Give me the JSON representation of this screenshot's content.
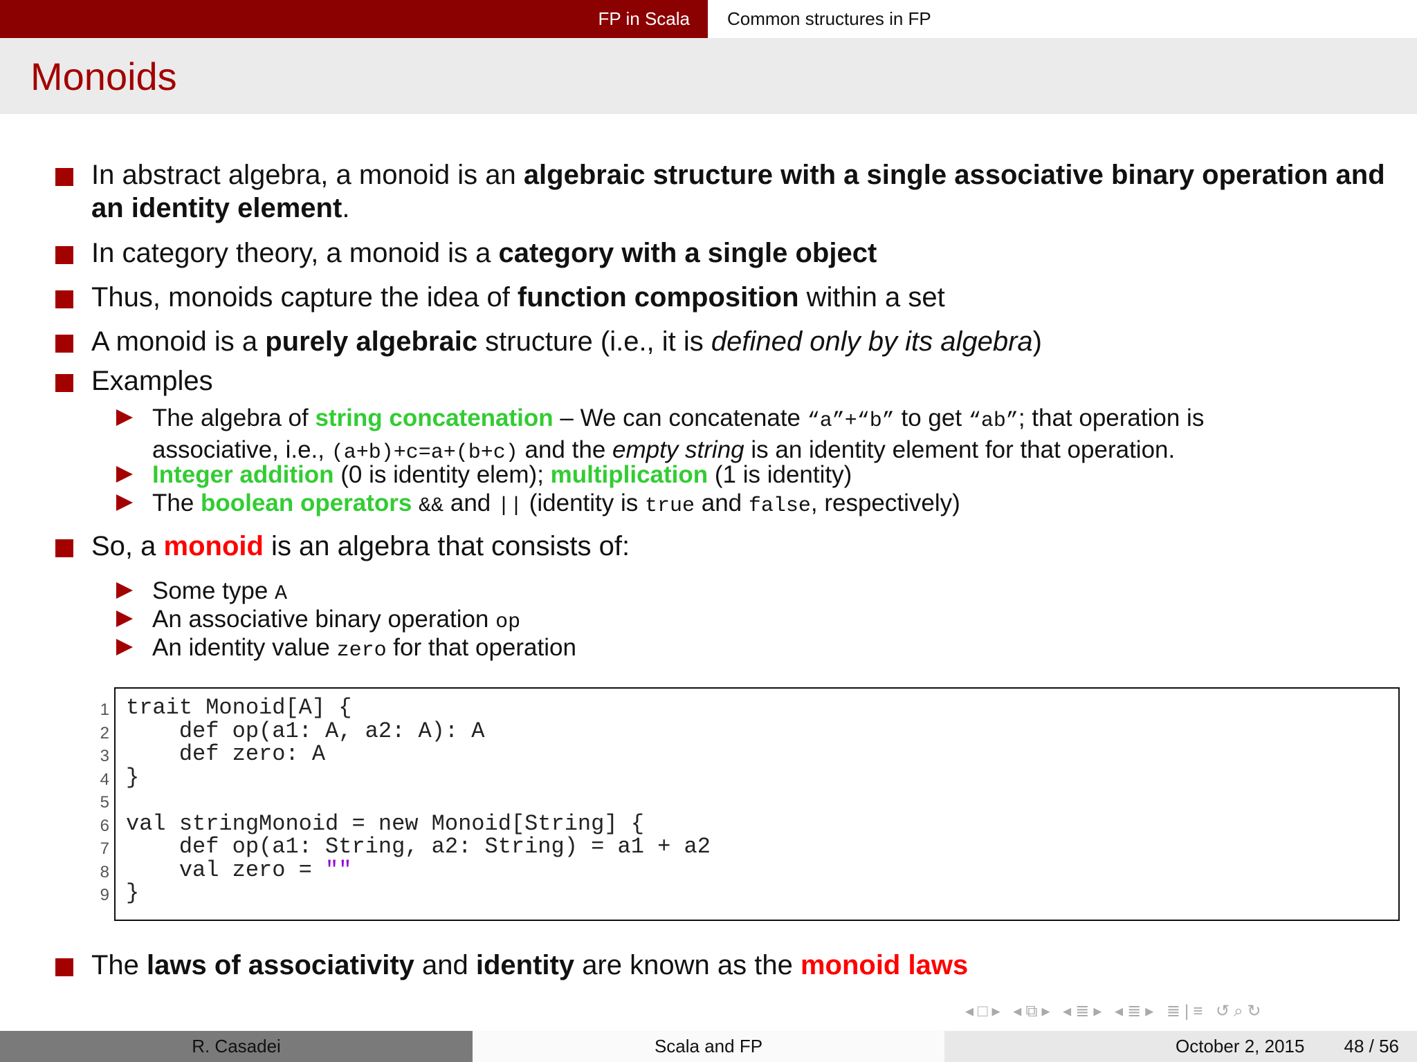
{
  "header": {
    "section": "FP in Scala",
    "subsection": "Common structures in FP"
  },
  "slide": {
    "title": "Monoids"
  },
  "bullets": {
    "b1": {
      "pre": "In abstract algebra, a monoid is an ",
      "bold": "algebraic structure with a single associative binary operation and an identity element",
      "post": "."
    },
    "b2": {
      "pre": "In category theory, a monoid is a ",
      "bold": "category with a single object"
    },
    "b3": {
      "pre": "Thus, monoids capture the idea of ",
      "bold": "function composition",
      "post": " within a set"
    },
    "b4": {
      "pre": "A monoid is a ",
      "bold": "purely algebraic",
      "mid": " structure (i.e., it is ",
      "italic": "defined only by its algebra",
      "post": ")"
    },
    "b5": {
      "text": "Examples"
    },
    "b6": {
      "pre": "So, a ",
      "highlight": "monoid",
      "post": " is an algebra that consists of:"
    },
    "b7": {
      "pre": "The ",
      "bold1": "laws of associativity",
      "mid": " and ",
      "bold2": "identity",
      "mid2": " are known as the ",
      "highlight": "monoid laws"
    }
  },
  "examples": {
    "e1": {
      "pre": "The algebra of ",
      "highlight": "string concatenation",
      "mid": " – We can concatenate ",
      "code1": "“a”+“b”",
      "mid2": " to get ",
      "code2": "“ab”",
      "post": "; that operation is",
      "line2_pre": "associative, i.e., ",
      "code3": "(a+b)+c=a+(b+c)",
      "line2_mid": " and the ",
      "italic": "empty string",
      "line2_post": " is an identity element for that operation."
    },
    "e2": {
      "highlight1": "Integer addition",
      "mid": " (0 is identity elem); ",
      "highlight2": "multiplication",
      "post": " (1 is identity)"
    },
    "e3": {
      "pre": "The ",
      "highlight": "boolean operators",
      "code1": "&&",
      "mid": " and ",
      "code2": "||",
      "mid2": " (identity is ",
      "code3": "true",
      "mid3": " and ",
      "code4": "false",
      "post": ", respectively)"
    }
  },
  "consists": {
    "c1": {
      "text": "Some type ",
      "code": "A"
    },
    "c2": {
      "text": "An associative binary operation ",
      "code": "op"
    },
    "c3": {
      "text": "An identity value ",
      "code": "zero",
      "post": " for that operation"
    }
  },
  "code": {
    "line_numbers": [
      "1",
      "2",
      "3",
      "4",
      "5",
      "6",
      "7",
      "8",
      "9"
    ],
    "lines": [
      "trait Monoid[A] {",
      "    def op(a1: A, a2: A): A",
      "    def zero: A",
      "}",
      "",
      "val stringMonoid = new Monoid[String] {",
      "    def op(a1: String, a2: String) = a1 + a2",
      "    val zero = ",
      "}"
    ],
    "string_literal": "\"\""
  },
  "footer": {
    "author": "R. Casadei",
    "topic": "Scala and FP",
    "date": "October 2, 2015",
    "page": "48 / 56"
  },
  "colors": {
    "brand": "#8b0000",
    "title": "#a30000",
    "green": "#33cc33",
    "red": "#ff0000",
    "string": "#9400d3"
  }
}
